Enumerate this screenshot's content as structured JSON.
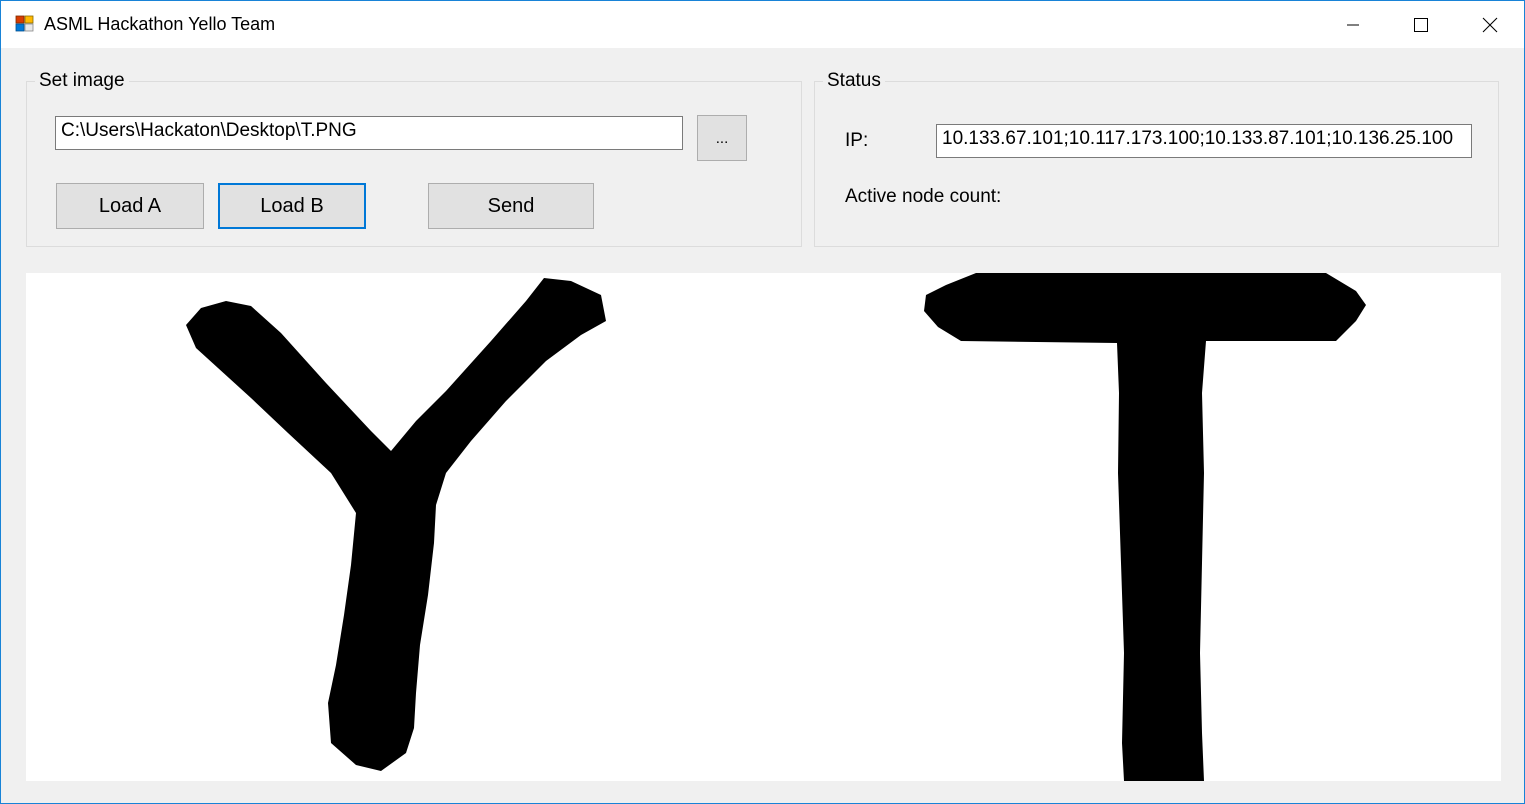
{
  "window": {
    "title": "ASML Hackathon Yello Team",
    "icon": "app-icon",
    "controls": {
      "minimize_icon": "minimize-icon",
      "maximize_icon": "maximize-icon",
      "close_icon": "close-icon"
    }
  },
  "set_image": {
    "legend": "Set image",
    "path_value": "C:\\Users\\Hackaton\\Desktop\\T.PNG",
    "browse_label": "...",
    "load_a_label": "Load A",
    "load_b_label": "Load B",
    "send_label": "Send"
  },
  "status": {
    "legend": "Status",
    "ip_label": "IP:",
    "ip_value": "10.133.67.101;10.117.173.100;10.133.87.101;10.136.25.100",
    "active_node_label": "Active node count:"
  },
  "images": {
    "image_a": "handwritten letter Y",
    "image_b": "handwritten letter T"
  },
  "colors": {
    "window_border": "#1883d7",
    "focus_border": "#0078d7",
    "ink": "#000000"
  }
}
